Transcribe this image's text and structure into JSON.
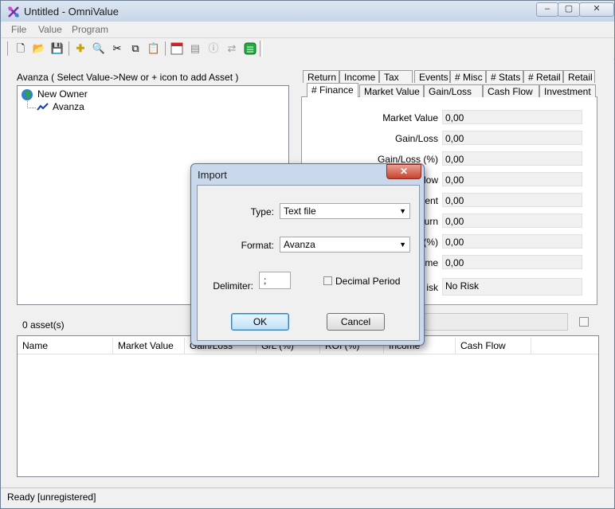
{
  "window": {
    "title": "Untitled - OmniValue"
  },
  "menu": [
    "File",
    "Value",
    "Program"
  ],
  "toolbar": {
    "icons": [
      "new-icon",
      "open-icon",
      "save-icon",
      "add-icon",
      "find-icon",
      "cut-icon",
      "copy-icon",
      "paste-icon",
      "calendar-icon",
      "report-icon",
      "info-icon",
      "refresh-icon",
      "update-icon"
    ]
  },
  "tree": {
    "header": "Avanza  ( Select Value->New or + icon to add Asset )",
    "root": "New Owner",
    "child": "Avanza"
  },
  "assets_count": "0 asset(s)",
  "tabs_top": [
    "Return",
    "Income",
    "Tax",
    "Events",
    "# Misc",
    "# Stats",
    "# Retail",
    "Retail"
  ],
  "tabs_bottom": [
    "# Finance",
    "Market Value",
    "Gain/Loss",
    "Cash Flow",
    "Investment"
  ],
  "finance": {
    "fields": [
      {
        "label": "Market Value",
        "value": "0,00"
      },
      {
        "label": "Gain/Loss",
        "value": "0,00"
      },
      {
        "label": "Gain/Loss (%)",
        "value": "0,00"
      },
      {
        "label": "low",
        "value": "0,00"
      },
      {
        "label": "ent",
        "value": "0,00"
      },
      {
        "label": "turn",
        "value": "0,00"
      },
      {
        "label": "(%)",
        "value": "0,00"
      },
      {
        "label": "ome",
        "value": "0,00"
      },
      {
        "label": "isk",
        "value": "No Risk"
      }
    ]
  },
  "table": {
    "columns": [
      "Name",
      "Market Value",
      "Gain/Loss",
      "G/L (%)",
      "ROI (%)",
      "Income",
      "Cash Flow"
    ]
  },
  "status": "Ready [unregistered]",
  "dialog": {
    "title": "Import",
    "close": "✕",
    "type_label": "Type:",
    "type_value": "Text file",
    "format_label": "Format:",
    "format_value": "Avanza",
    "delimiter_label": "Delimiter:",
    "delimiter_value": ";",
    "decimal_label": "Decimal Period",
    "ok": "OK",
    "cancel": "Cancel"
  }
}
